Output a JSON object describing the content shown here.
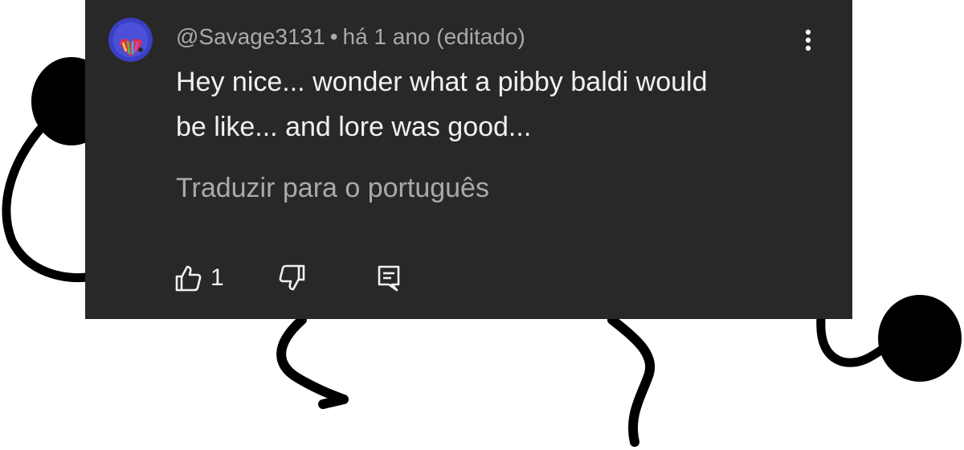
{
  "comment": {
    "author": "@Savage3131",
    "separator": "•",
    "time": "há 1 ano (editado)",
    "lines": [
      "Hey nice... wonder what a pibby baldi would",
      "be like... and lore was good..."
    ],
    "translate_label": "Traduzir para o português",
    "like_count": "1"
  },
  "icons": {
    "avatar": "avatar",
    "more": "more-vert-icon",
    "like": "thumb-up-icon",
    "dislike": "thumb-down-icon",
    "reply": "comment-icon"
  },
  "colors": {
    "card_background": "#282828",
    "primary_text": "#f1f1f1",
    "secondary_text": "#aaaaaa",
    "doodle": "#000000",
    "page_background": "#ffffff"
  }
}
